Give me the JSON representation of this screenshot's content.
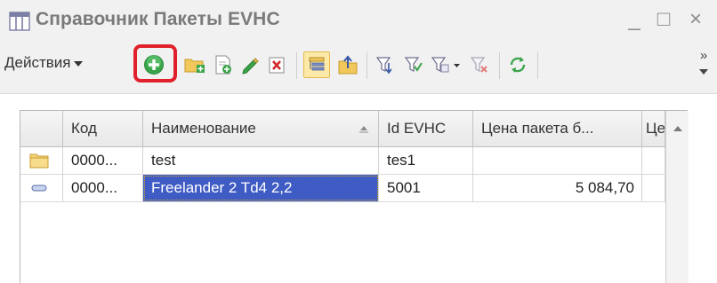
{
  "window": {
    "title": "Справочник Пакеты EVHC",
    "title_icon": "catalog-grid-icon",
    "controls": {
      "minimize": "_",
      "maximize": "□",
      "close": "×"
    }
  },
  "toolbar": {
    "actions_label": "Действия",
    "more_label": "»",
    "buttons": [
      {
        "name": "add",
        "icon": "add-circle-icon",
        "highlighted": true
      },
      {
        "name": "add-folder",
        "icon": "add-folder-icon"
      },
      {
        "name": "copy",
        "icon": "copy-document-icon"
      },
      {
        "name": "edit",
        "icon": "pencil-icon"
      },
      {
        "name": "delete",
        "icon": "delete-mark-icon"
      },
      {
        "name": "hierarchy-view",
        "icon": "hierarchy-list-icon",
        "pressed": true
      },
      {
        "name": "go-up-level",
        "icon": "level-up-icon"
      },
      {
        "name": "filter-settings",
        "icon": "filter-settings-icon"
      },
      {
        "name": "filter-by-value",
        "icon": "filter-value-icon"
      },
      {
        "name": "filter-history",
        "icon": "filter-history-icon"
      },
      {
        "name": "filter-clear",
        "icon": "filter-clear-icon"
      },
      {
        "name": "refresh",
        "icon": "refresh-icon"
      }
    ]
  },
  "grid": {
    "columns": [
      "",
      "Код",
      "Наименование",
      "Id EVHC",
      "Цена пакета б...",
      "Це"
    ],
    "rows": [
      {
        "type": "folder",
        "icon": "folder-icon",
        "code": "0000...",
        "name": "test",
        "id_evhc": "tes1",
        "price": "",
        "extra": ""
      },
      {
        "type": "item",
        "icon": "item-dash-icon",
        "code": "0000...",
        "name": "Freelander 2 Td4 2,2",
        "id_evhc": "5001",
        "price": "5 084,70",
        "extra": "",
        "selected_column": "name"
      }
    ]
  },
  "colors": {
    "selection": "#3f5bc4",
    "highlight_frame": "#e0202a",
    "add_icon_green": "#3aa44a",
    "title_text": "#7a7a7a"
  }
}
